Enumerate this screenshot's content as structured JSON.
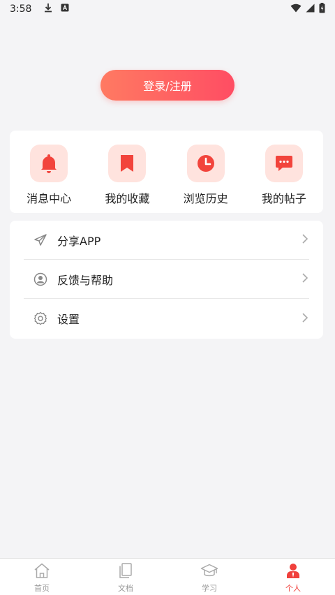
{
  "status_bar": {
    "time": "3:58"
  },
  "login": {
    "label": "登录/注册"
  },
  "quick_actions": [
    {
      "label": "消息中心",
      "icon": "bell-icon"
    },
    {
      "label": "我的收藏",
      "icon": "bookmark-icon"
    },
    {
      "label": "浏览历史",
      "icon": "clock-icon"
    },
    {
      "label": "我的帖子",
      "icon": "chat-icon"
    }
  ],
  "menu": [
    {
      "label": "分享APP",
      "icon": "share-icon"
    },
    {
      "label": "反馈与帮助",
      "icon": "user-circle-icon"
    },
    {
      "label": "设置",
      "icon": "gear-icon"
    }
  ],
  "tabs": [
    {
      "label": "首页",
      "icon": "home-icon"
    },
    {
      "label": "文档",
      "icon": "document-icon"
    },
    {
      "label": "学习",
      "icon": "graduation-cap-icon"
    },
    {
      "label": "个人",
      "icon": "person-icon",
      "active": true
    }
  ],
  "colors": {
    "accent": "#ff5a5f",
    "icon_bg": "#ffe3de",
    "icon_fg": "#f2443c",
    "tab_active": "#f0403c"
  }
}
